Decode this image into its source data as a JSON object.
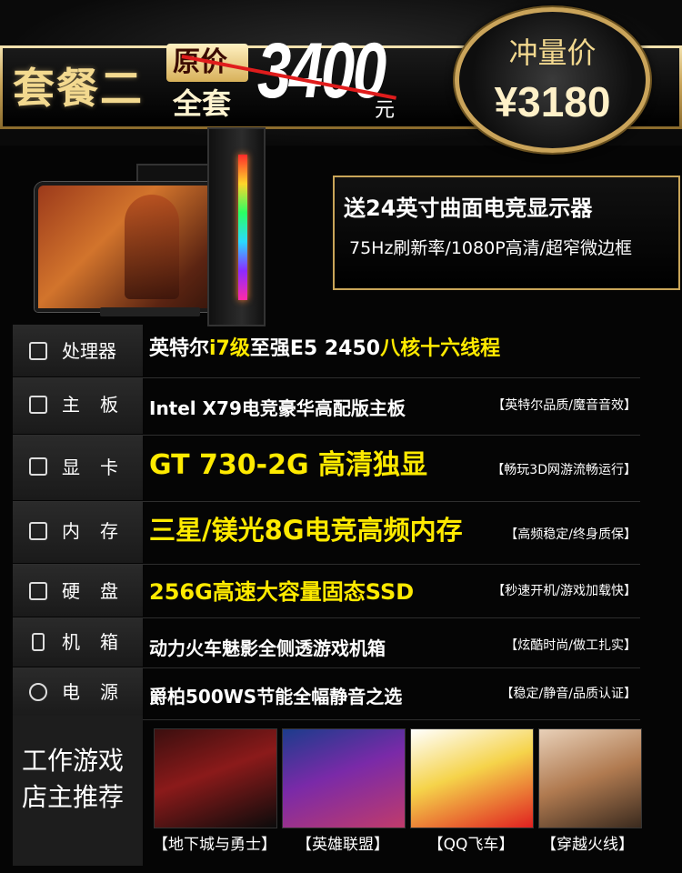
{
  "header": {
    "package": "套餐二",
    "orig_label": "原价",
    "full_label": "全套",
    "orig_price": "3400",
    "unit": "元"
  },
  "badge": {
    "title": "冲量价",
    "price": "¥3180"
  },
  "gift": {
    "title": "送24英寸曲面电竞显示器",
    "subtitle": "75Hz刷新率/1080P高清/超窄微边框"
  },
  "specs": [
    {
      "label": "处理器",
      "icon": "cpu-icon",
      "value_a": "英特尔",
      "value_b": "i7级",
      "value_c": "至强E5 2450",
      "value_d": "八核十六线程",
      "note": ""
    },
    {
      "label": "主板",
      "icon": "motherboard-icon",
      "value": "Intel X79电竞豪华高配版主板",
      "note": "【英特尔品质/魔音音效】"
    },
    {
      "label": "显卡",
      "icon": "gpu-icon",
      "value": "GT 730-2G 高清独显",
      "note": "【畅玩3D网游流畅运行】"
    },
    {
      "label": "内存",
      "icon": "memory-icon",
      "value": "三星/镁光8G电竞高频内存",
      "note": "【高频稳定/终身质保】"
    },
    {
      "label": "硬盘",
      "icon": "disk-icon",
      "value": "256G高速大容量固态SSD",
      "note": "【秒速开机/游戏加载快】"
    },
    {
      "label": "机箱",
      "icon": "case-icon",
      "value": "动力火车魅影全侧透游戏机箱",
      "note": "【炫酷时尚/做工扎实】"
    },
    {
      "label": "电源",
      "icon": "power-icon",
      "value": "爵柏500WS节能全幅静音之选",
      "note": "【稳定/静音/品质认证】"
    }
  ],
  "games": {
    "title_line1": "工作游戏",
    "title_line2": "店主推荐",
    "items": [
      "【地下城与勇士】",
      "【英雄联盟】",
      "【QQ飞车】",
      "【穿越火线】"
    ]
  }
}
